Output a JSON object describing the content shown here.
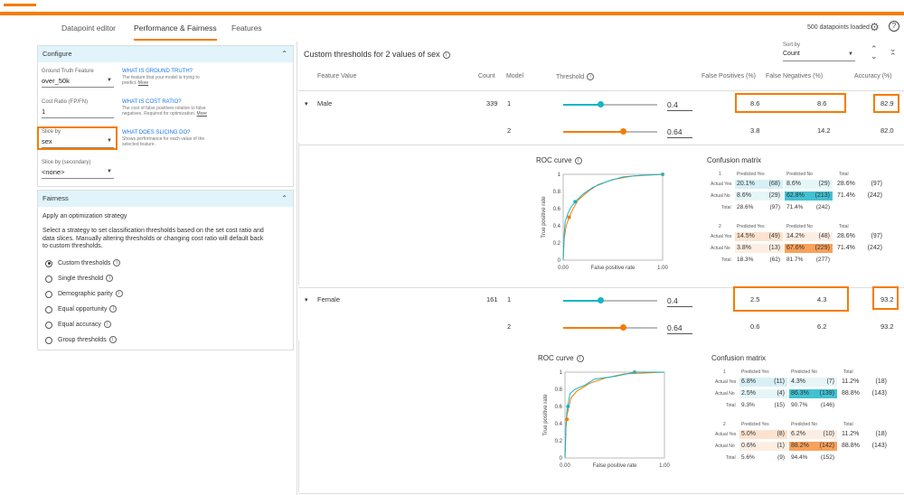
{
  "tabs": [
    "Datapoint editor",
    "Performance & Fairness",
    "Features"
  ],
  "header_right": {
    "datapoints": "500 datapoints loaded"
  },
  "configure": {
    "title": "Configure",
    "gt_label": "Ground Truth Feature",
    "gt_value": "over_50k",
    "gt_help_title": "WHAT IS GROUND TRUTH?",
    "gt_help": "The feature that your model is trying to predict.",
    "cost_label": "Cost Ratio (FP/FN)",
    "cost_value": "1",
    "cost_help_title": "WHAT IS COST RATIO?",
    "cost_help": "The cost of false positives relative to false negatives. Required for optimization.",
    "slice_label": "Slice by",
    "slice_value": "sex",
    "slice_help_title": "WHAT DOES SLICING DO?",
    "slice_help": "Shows performance for each value of the selected feature.",
    "slice2_label": "Slice by (secondary)",
    "slice2_value": "<none>",
    "more": "More"
  },
  "fairness": {
    "title": "Fairness",
    "apply": "Apply an optimization strategy",
    "desc": "Select a strategy to set classification thresholds based on the set cost ratio and data slices. Manually altering thresholds or changing cost ratio will default back to custom thresholds.",
    "options": [
      "Custom thresholds",
      "Single threshold",
      "Demographic parity",
      "Equal opportunity",
      "Equal accuracy",
      "Group thresholds"
    ],
    "selected": 0
  },
  "main": {
    "title": "Custom thresholds for 2 values of sex",
    "sort_label": "Sort by",
    "sort_value": "Count",
    "columns": [
      "Feature Value",
      "Count",
      "Model",
      "Threshold",
      "False Positives (%)",
      "False Negatives (%)",
      "Accuracy (%)"
    ]
  },
  "rows": [
    {
      "feature": "Male",
      "count": "339",
      "models": [
        {
          "model": "1",
          "threshold": "0.4",
          "thr_value": 0.4,
          "fp": "8.6",
          "fn": "8.6",
          "acc": "82.9"
        },
        {
          "model": "2",
          "threshold": "0.64",
          "thr_value": 0.64,
          "fp": "3.8",
          "fn": "14.2",
          "acc": "82.0"
        }
      ],
      "roc_title": "ROC curve",
      "cm_title": "Confusion matrix",
      "cm": [
        {
          "model": "1",
          "ay": [
            "20.1%",
            "(68)",
            "8.6%",
            "(29)",
            "28.6%",
            "(97)"
          ],
          "an": [
            "8.6%",
            "(29)",
            "62.8%",
            "(213)",
            "71.4%",
            "(242)"
          ],
          "tot": [
            "28.6%",
            "(97)",
            "71.4%",
            "(242)"
          ]
        },
        {
          "model": "2",
          "ay": [
            "14.5%",
            "(49)",
            "14.2%",
            "(48)",
            "28.6%",
            "(97)"
          ],
          "an": [
            "3.8%",
            "(13)",
            "67.6%",
            "(229)",
            "71.4%",
            "(242)"
          ],
          "tot": [
            "18.3%",
            "(62)",
            "81.7%",
            "(277)"
          ]
        }
      ]
    },
    {
      "feature": "Female",
      "count": "161",
      "models": [
        {
          "model": "1",
          "threshold": "0.4",
          "thr_value": 0.4,
          "fp": "2.5",
          "fn": "4.3",
          "acc": "93.2"
        },
        {
          "model": "2",
          "threshold": "0.64",
          "thr_value": 0.64,
          "fp": "0.6",
          "fn": "6.2",
          "acc": "93.2"
        }
      ],
      "roc_title": "ROC curve",
      "cm_title": "Confusion matrix",
      "cm": [
        {
          "model": "1",
          "ay": [
            "6.8%",
            "(11)",
            "4.3%",
            "(7)",
            "11.2%",
            "(18)"
          ],
          "an": [
            "2.5%",
            "(4)",
            "86.3%",
            "(139)",
            "88.8%",
            "(143)"
          ],
          "tot": [
            "9.3%",
            "(15)",
            "90.7%",
            "(146)"
          ]
        },
        {
          "model": "2",
          "ay": [
            "5.0%",
            "(8)",
            "6.2%",
            "(10)",
            "11.2%",
            "(18)"
          ],
          "an": [
            "0.6%",
            "(1)",
            "88.2%",
            "(142)",
            "88.8%",
            "(143)"
          ],
          "tot": [
            "5.6%",
            "(9)",
            "94.4%",
            "(152)"
          ]
        }
      ]
    }
  ],
  "cm_labels": {
    "py": "Predicted Yes",
    "pn": "Predicted No",
    "total": "Total",
    "ay": "Actual Yes",
    "an": "Actual No",
    "tot": "Total"
  },
  "roc_axes": {
    "xlabel": "False positive rate",
    "ylabel": "True positive rate",
    "xticks": [
      "0.00",
      "1.00"
    ],
    "yticks": [
      "0",
      "0.2",
      "0.4",
      "0.6",
      "0.8",
      "1"
    ]
  },
  "colors": {
    "model1": "#12b5cb",
    "model2": "#f57c00",
    "accent": "#f57c00",
    "panel_header": "#e1f4fb"
  }
}
